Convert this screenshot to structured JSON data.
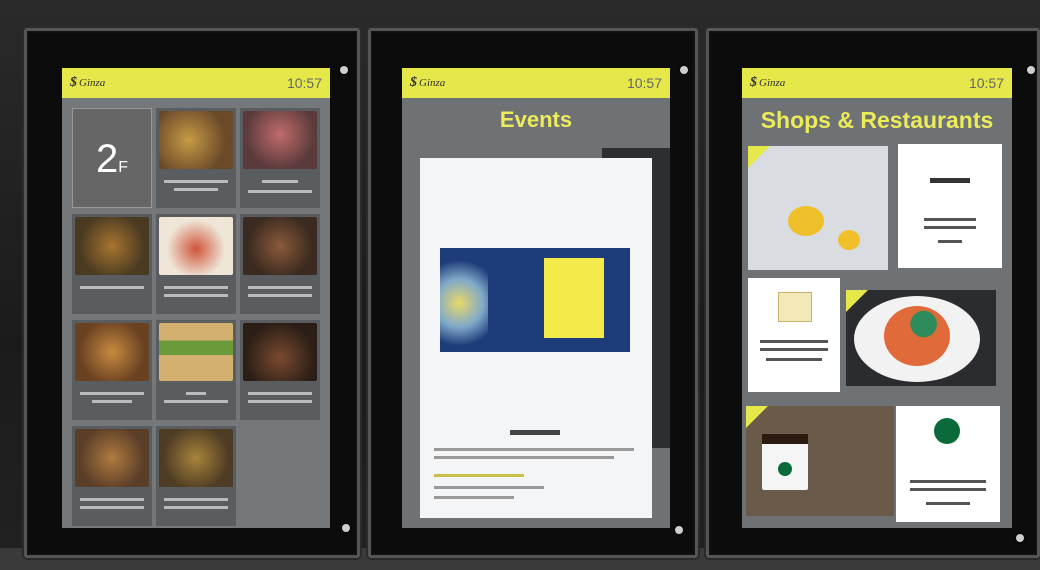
{
  "left_panel": {
    "logo": "Ginza",
    "clock": "10:57",
    "floor_number": "2",
    "floor_suffix": "F"
  },
  "middle_panel": {
    "logo": "Ginza",
    "clock": "10:57",
    "heading": "Events"
  },
  "right_panel": {
    "logo": "Ginza",
    "clock": "10:57",
    "heading": "Shops & Restaurants"
  },
  "colors": {
    "accent_yellow": "#e6e84a",
    "heading_yellow": "#eceb5a",
    "screen_grey": "#6f7275"
  }
}
